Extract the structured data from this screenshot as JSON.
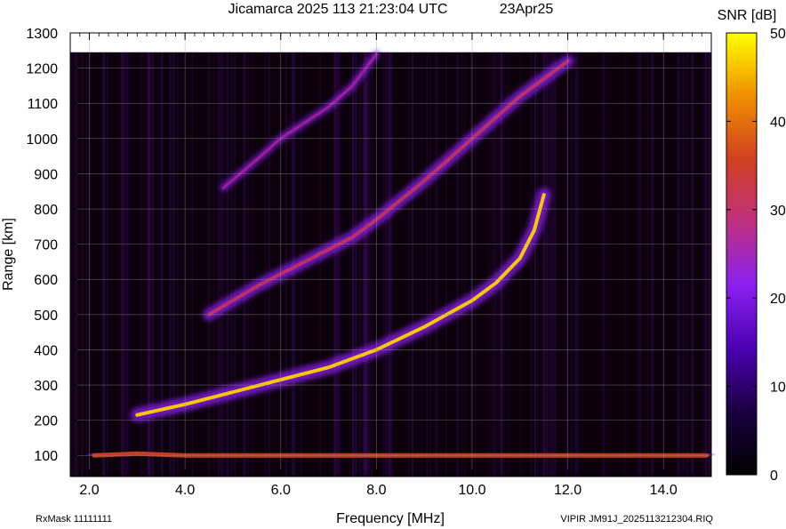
{
  "header": {
    "title": "Jicamarca 2025 113 21:23:04 UTC",
    "date": "23Apr25"
  },
  "footer": {
    "rxmask": "RxMask 11111111",
    "file": "VIPIR  JM91J_2025113212304.RIQ"
  },
  "chart_data": {
    "type": "heatmap",
    "title": "Jicamarca 2025 113 21:23:04 UTC",
    "xlabel": "Frequency [MHz]",
    "ylabel": "Range [km]",
    "xlim": [
      1.6,
      15.0
    ],
    "ylim": [
      40,
      1300
    ],
    "xticks": [
      "2.0",
      "4.0",
      "6.0",
      "8.0",
      "10.0",
      "12.0",
      "14.0"
    ],
    "yticks": [
      "100",
      "200",
      "300",
      "400",
      "500",
      "600",
      "700",
      "800",
      "900",
      "1000",
      "1100",
      "1200",
      "1300"
    ],
    "grid": true,
    "colorbar": {
      "label": "SNR [dB]",
      "range": [
        0,
        50
      ],
      "ticks": [
        "0",
        "10",
        "20",
        "30",
        "40",
        "50"
      ],
      "colors": [
        "#000000",
        "#1a0040",
        "#4b00b0",
        "#8a20f0",
        "#c03080",
        "#d04020",
        "#f09000",
        "#ffff00"
      ]
    },
    "series": [
      {
        "name": "",
        "points": [
          [
            2.1,
            100
          ],
          [
            3.0,
            105
          ],
          [
            4.0,
            100
          ],
          [
            5.0,
            100
          ],
          [
            6.0,
            100
          ],
          [
            7.0,
            100
          ],
          [
            8.0,
            100
          ],
          [
            9.0,
            100
          ],
          [
            10.0,
            100
          ],
          [
            11.0,
            100
          ],
          [
            12.0,
            100
          ],
          [
            13.0,
            100
          ],
          [
            14.0,
            100
          ],
          [
            14.9,
            100
          ]
        ]
      },
      {
        "name": "",
        "points": [
          [
            3.0,
            215
          ],
          [
            4.0,
            245
          ],
          [
            5.0,
            280
          ],
          [
            6.0,
            315
          ],
          [
            7.0,
            350
          ],
          [
            8.0,
            400
          ],
          [
            9.0,
            465
          ],
          [
            10.0,
            540
          ],
          [
            10.5,
            590
          ],
          [
            11.0,
            660
          ],
          [
            11.3,
            740
          ],
          [
            11.5,
            840
          ]
        ]
      },
      {
        "name": "",
        "points": [
          [
            4.5,
            500
          ],
          [
            5.5,
            580
          ],
          [
            6.5,
            650
          ],
          [
            7.5,
            720
          ],
          [
            8.0,
            770
          ],
          [
            9.0,
            880
          ],
          [
            9.5,
            940
          ],
          [
            10.0,
            1000
          ],
          [
            10.5,
            1060
          ],
          [
            11.0,
            1120
          ],
          [
            11.5,
            1170
          ],
          [
            12.0,
            1220
          ]
        ]
      },
      {
        "name": "",
        "points": [
          [
            4.8,
            860
          ],
          [
            5.5,
            940
          ],
          [
            6.0,
            1000
          ],
          [
            7.0,
            1090
          ],
          [
            7.5,
            1150
          ],
          [
            8.0,
            1240
          ]
        ]
      }
    ]
  }
}
